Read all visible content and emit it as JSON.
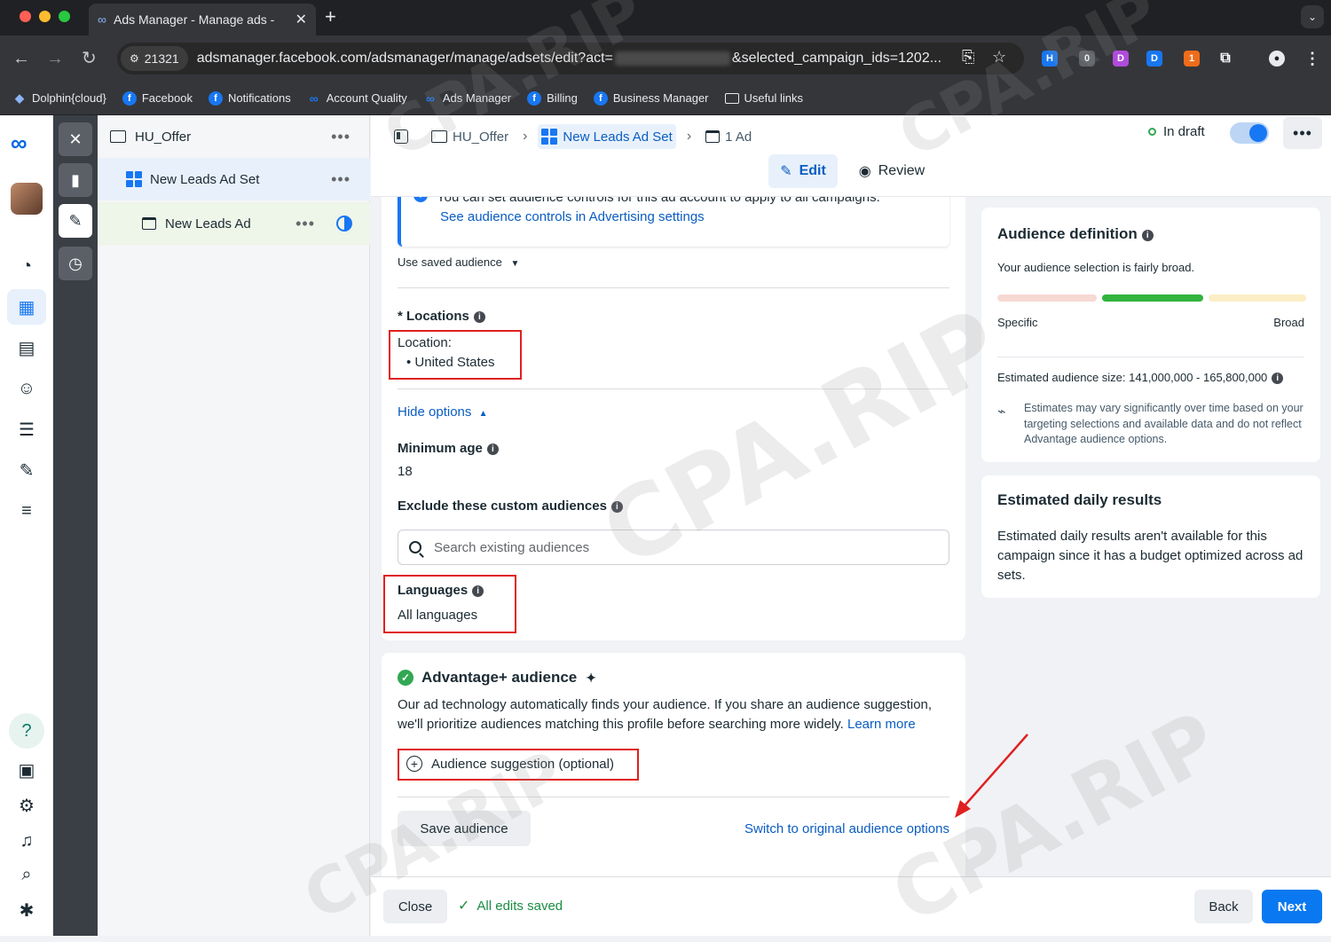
{
  "browser": {
    "tab_title": "Ads Manager - Manage ads -",
    "site_chip": "21321",
    "url_start": "adsmanager.facebook.com/adsmanager/manage/adsets/edit?act=",
    "url_end": "&selected_campaign_ids=1202...",
    "extension_badges": {
      "ext2": "0",
      "ext6": "1"
    },
    "bookmarks": [
      {
        "label": "Dolphin{cloud}",
        "icon": "dolphin-icon"
      },
      {
        "label": "Facebook",
        "icon": "facebook-icon"
      },
      {
        "label": "Notifications",
        "icon": "facebook-icon"
      },
      {
        "label": "Account Quality",
        "icon": "meta-icon"
      },
      {
        "label": "Ads Manager",
        "icon": "meta-icon"
      },
      {
        "label": "Billing",
        "icon": "facebook-icon"
      },
      {
        "label": "Business Manager",
        "icon": "facebook-icon"
      },
      {
        "label": "Useful links",
        "icon": "folder-icon"
      }
    ]
  },
  "tree": {
    "campaign": "HU_Offer",
    "adset": "New Leads Ad Set",
    "ad": "New Leads Ad"
  },
  "header": {
    "breadcrumb": {
      "campaign": "HU_Offer",
      "adset": "New Leads Ad Set",
      "ads": "1 Ad"
    },
    "status": "In draft",
    "edit_tab": "Edit",
    "review_tab": "Review"
  },
  "audience": {
    "info_cut": "You can set audience controls for this ad account to apply to all campaigns.",
    "info_link": "See audience controls in Advertising settings",
    "saved_audience": "Use saved audience",
    "locations_label": "* Locations",
    "location_title": "Location:",
    "location_value": "United States",
    "hide_options": "Hide options",
    "min_age_label": "Minimum age",
    "min_age_value": "18",
    "exclude_label": "Exclude these custom audiences",
    "search_placeholder": "Search existing audiences",
    "languages_label": "Languages",
    "languages_value": "All languages"
  },
  "advantage": {
    "title": "Advantage+ audience",
    "description": "Our ad technology automatically finds your audience. If you share an audience suggestion, we'll prioritize audiences matching this profile before searching more widely.",
    "learn_more": "Learn more",
    "suggestion": "Audience suggestion (optional)",
    "save_audience": "Save audience",
    "switch_link": "Switch to original audience options"
  },
  "definition": {
    "title": "Audience definition",
    "subtitle": "Your audience selection is fairly broad.",
    "specific": "Specific",
    "broad": "Broad",
    "size": "Estimated audience size: 141,000,000 - 165,800,000",
    "note": "Estimates may vary significantly over time based on your targeting selections and available data and do not reflect Advantage audience options."
  },
  "daily": {
    "title": "Estimated daily results",
    "text": "Estimated daily results aren't available for this campaign since it has a budget optimized across ad sets."
  },
  "footer": {
    "close": "Close",
    "saved": "All edits saved",
    "back": "Back",
    "next": "Next"
  },
  "watermark": "CPA.RIP",
  "colors": {
    "accent": "#1877f2",
    "link": "#0a5dc2",
    "success": "#32a852",
    "highlight": "#e02020",
    "primary_button": "#0a78f0"
  }
}
